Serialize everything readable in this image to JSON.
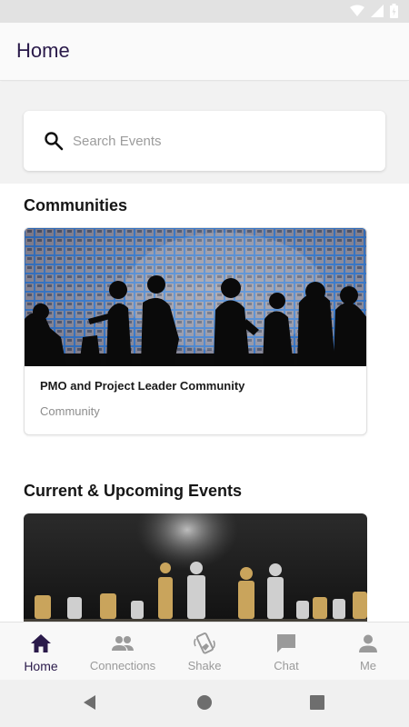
{
  "app_bar": {
    "title": "Home"
  },
  "search": {
    "placeholder": "Search Events"
  },
  "communities": {
    "title": "Communities",
    "card": {
      "title": "PMO and Project Leader Community",
      "subtitle": "Community"
    }
  },
  "events": {
    "title": "Current & Upcoming Events"
  },
  "bottom_nav": {
    "items": [
      {
        "label": "Home",
        "icon": "home-icon",
        "active": true
      },
      {
        "label": "Connections",
        "icon": "people-icon",
        "active": false
      },
      {
        "label": "Shake",
        "icon": "shake-phone-icon",
        "active": false
      },
      {
        "label": "Chat",
        "icon": "chat-icon",
        "active": false
      },
      {
        "label": "Me",
        "icon": "person-icon",
        "active": false
      }
    ]
  },
  "colors": {
    "accent": "#2a1a4a",
    "inactive": "#9a9a9a"
  }
}
